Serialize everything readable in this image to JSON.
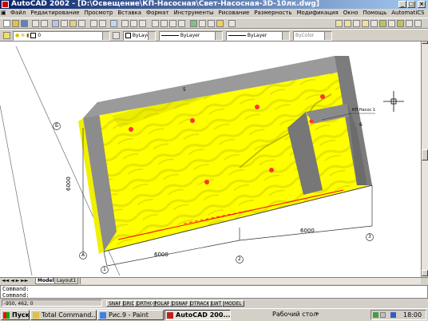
{
  "window": {
    "title": "AutoCAD 2002 - [D:\\Освещение\\КП-Насосная\\Свет-Насосная-3D-10лк.dwg]",
    "minimize": "_",
    "maximize": "□",
    "close": "×"
  },
  "menu": [
    "Файл",
    "Редактирование",
    "Просмотр",
    "Вставка",
    "Формат",
    "Инструменты",
    "Рисование",
    "Размерность",
    "Модификация",
    "Окно",
    "Помощь",
    "AutomatiCS"
  ],
  "layer_toolbar": {
    "layer_value": "0",
    "color_value": "ByLayer",
    "linetype_value": "ByLayer",
    "lineweight_value": "ByLayer",
    "plotstyle_value": "ByColor"
  },
  "drawing": {
    "dim_bottom": "6000",
    "dim_right_bottom": "6000",
    "dim_left": "6000",
    "grid_a": "А",
    "grid_b": "Б",
    "grid_1": "1",
    "grid_2": "2",
    "grid_3": "3",
    "label_kp": "КП Насос 1",
    "label_5": "5",
    "label_6": "6"
  },
  "tabs": {
    "model": "Model",
    "layout1": "Layout1"
  },
  "command": {
    "line1": "Command:",
    "line2": "Command:"
  },
  "status": {
    "coords": "-950, 462, 0",
    "buttons": [
      "SNAP",
      "GRID",
      "ORTHO",
      "POLAR",
      "OSNAP",
      "OTRACK",
      "LWT",
      "MODEL"
    ]
  },
  "taskbar": {
    "start": "Пуск",
    "items": [
      "Total Command...",
      "Рис.9 - Paint",
      "AutoCAD 200..."
    ],
    "desktop": "Рабочий стол",
    "time": "18:00"
  },
  "colors": {
    "floor": "#ffff00",
    "wall": "#8c8c8c",
    "wall_top": "#ffffff",
    "lamp": "#ff3333",
    "title_start": "#0a246a"
  }
}
